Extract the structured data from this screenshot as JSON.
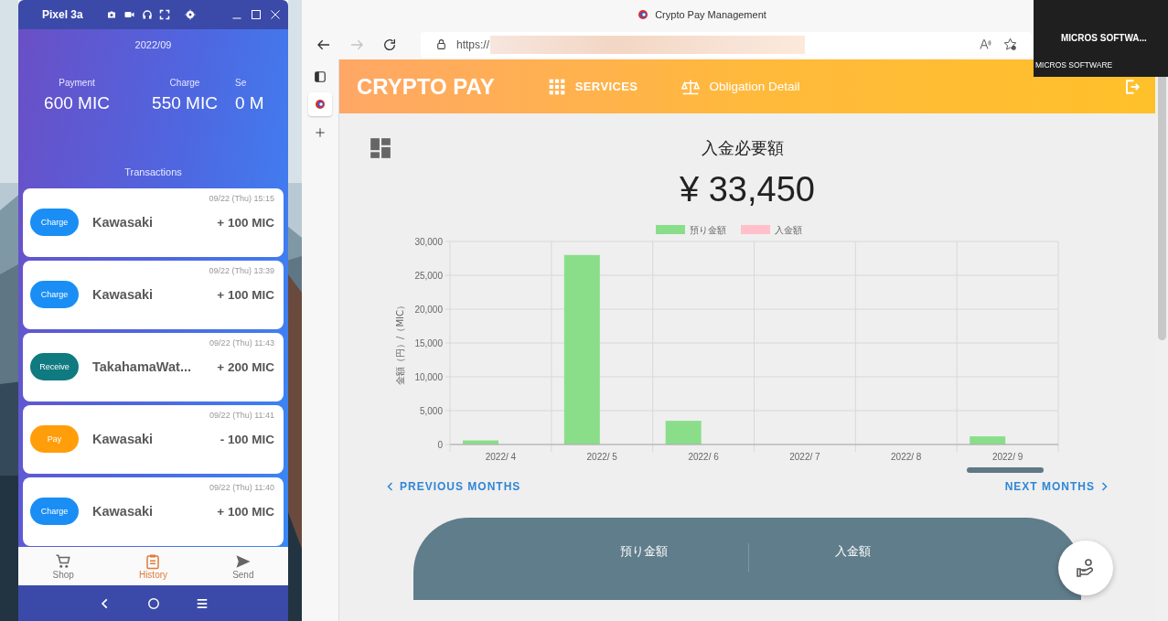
{
  "phone": {
    "device": "Pixel 3a",
    "month": "2022/09",
    "stats": [
      {
        "label": "Payment",
        "value": "600 MIC"
      },
      {
        "label": "Charge",
        "value": "550 MIC"
      },
      {
        "label": "Se",
        "value": "0 M"
      }
    ],
    "transactions_title": "Transactions",
    "transactions": [
      {
        "kind": "charge",
        "badge": "Charge",
        "name": "Kawasaki",
        "time": "09/22 (Thu) 15:15",
        "amount": "+ 100 MIC"
      },
      {
        "kind": "charge",
        "badge": "Charge",
        "name": "Kawasaki",
        "time": "09/22 (Thu) 13:39",
        "amount": "+ 100 MIC"
      },
      {
        "kind": "receive",
        "badge": "Receive",
        "name": "TakahamaWat...",
        "time": "09/22 (Thu) 11:43",
        "amount": "+ 200 MIC"
      },
      {
        "kind": "pay",
        "badge": "Pay",
        "name": "Kawasaki",
        "time": "09/22 (Thu) 11:41",
        "amount": "- 100 MIC"
      },
      {
        "kind": "charge",
        "badge": "Charge",
        "name": "Kawasaki",
        "time": "09/22 (Thu) 11:40",
        "amount": "+ 100 MIC"
      }
    ],
    "nav": [
      {
        "kind": "cart",
        "label": "Shop",
        "selected": false
      },
      {
        "kind": "clipboard",
        "label": "History",
        "selected": true
      },
      {
        "kind": "send",
        "label": "Send",
        "selected": false
      }
    ]
  },
  "browser": {
    "tab_title": "Crypto Pay Management",
    "address": "https://",
    "forward": {
      "disabled": true
    },
    "overlay": {
      "title": "MICROS  SOFTWA...",
      "caption": "MICROS SOFTWARE"
    },
    "app": {
      "brand": "CRYPTO PAY",
      "menu": [
        {
          "kind": "grid",
          "label": "SERVICES"
        },
        {
          "kind": "scale",
          "label": "Obligation Detail"
        }
      ],
      "heading": "入金必要額",
      "amount": "¥ 33,450",
      "chart_data": {
        "type": "bar",
        "ylabel": "金額（円）/（MIC）",
        "categories": [
          "2022/ 4",
          "2022/ 5",
          "2022/ 6",
          "2022/ 7",
          "2022/ 8",
          "2022/ 9"
        ],
        "series": [
          {
            "name": "預り金額",
            "color": "#8ade8a",
            "values": [
              600,
              28000,
              3500,
              0,
              0,
              1200
            ]
          },
          {
            "name": "入金額",
            "color": "#ffc0cb",
            "values": [
              0,
              0,
              0,
              0,
              0,
              0
            ]
          }
        ],
        "ylim": [
          0,
          30000
        ],
        "grid": true,
        "legend": true,
        "yticks": [
          {
            "value": 0,
            "label": "0"
          },
          {
            "value": 5000,
            "label": "5,000"
          },
          {
            "value": 10000,
            "label": "10,000"
          },
          {
            "value": 15000,
            "label": "15,000"
          },
          {
            "value": 20000,
            "label": "20,000"
          },
          {
            "value": 25000,
            "label": "25,000"
          },
          {
            "value": 30000,
            "label": "30,000"
          }
        ]
      },
      "prev": "PREVIOUS MONTHS",
      "next": "NEXT MONTHS",
      "panel_columns": [
        "預り金額",
        "入金額"
      ]
    }
  }
}
